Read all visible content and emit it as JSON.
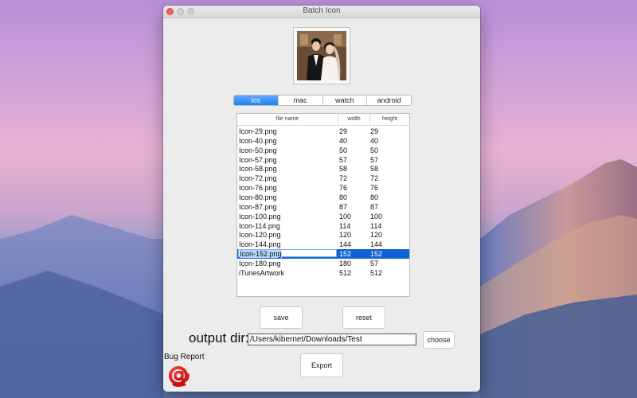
{
  "window": {
    "title": "Batch Icon"
  },
  "tabs": [
    {
      "label": "ios",
      "selected": true
    },
    {
      "label": "mac",
      "selected": false
    },
    {
      "label": "watch",
      "selected": false
    },
    {
      "label": "android",
      "selected": false
    }
  ],
  "table": {
    "columns": [
      "file name",
      "width",
      "height"
    ],
    "rows": [
      {
        "file": "Icon-29.png",
        "width": "29",
        "height": "29"
      },
      {
        "file": "Icon-40.png",
        "width": "40",
        "height": "40"
      },
      {
        "file": "Icon-50.png",
        "width": "50",
        "height": "50"
      },
      {
        "file": "Icon-57.png",
        "width": "57",
        "height": "57"
      },
      {
        "file": "Icon-58.png",
        "width": "58",
        "height": "58"
      },
      {
        "file": "Icon-72.png",
        "width": "72",
        "height": "72"
      },
      {
        "file": "Icon-76.png",
        "width": "76",
        "height": "76"
      },
      {
        "file": "Icon-80.png",
        "width": "80",
        "height": "80"
      },
      {
        "file": "Icon-87.png",
        "width": "87",
        "height": "87"
      },
      {
        "file": "Icon-100.png",
        "width": "100",
        "height": "100"
      },
      {
        "file": "Icon-114.png",
        "width": "114",
        "height": "114"
      },
      {
        "file": "Icon-120.png",
        "width": "120",
        "height": "120"
      },
      {
        "file": "Icon-144.png",
        "width": "144",
        "height": "144"
      },
      {
        "file": "Icon-152.png",
        "width": "152",
        "height": "152"
      },
      {
        "file": "Icon-180.png",
        "width": "180",
        "height": "57"
      },
      {
        "file": "iTunesArtwork",
        "width": "512",
        "height": "512"
      }
    ],
    "selected_index": 13
  },
  "buttons": {
    "save": "save",
    "reset": "reset",
    "choose": "choose",
    "export": "Export"
  },
  "output": {
    "label": "output dir:",
    "path": "/Users/kibernet/Downloads/Test"
  },
  "bug_report": {
    "label": "Bug Report",
    "icon": "at-sign-icon"
  },
  "colors": {
    "selection": "#1063d6",
    "tab_active": "#1a82f6",
    "bug_icon": "#e02020"
  }
}
